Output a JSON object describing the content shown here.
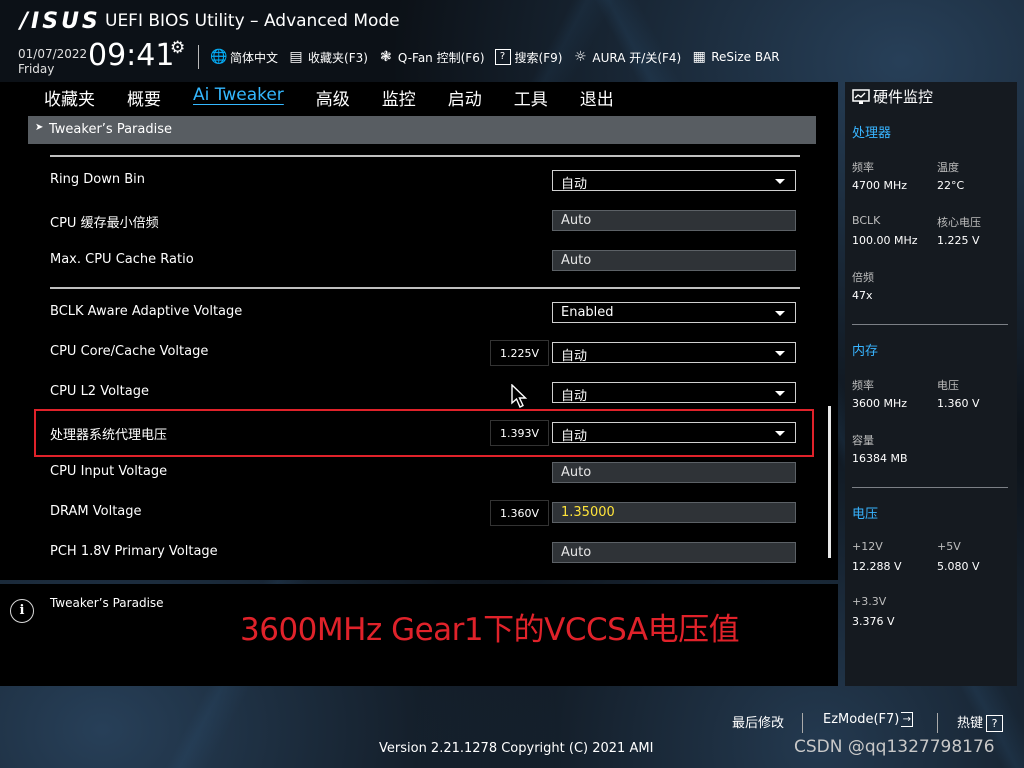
{
  "header": {
    "logo": "/ISUS",
    "title": "UEFI BIOS Utility – Advanced Mode",
    "date": "01/07/2022",
    "day": "Friday",
    "time": "09:41",
    "toolbar": [
      {
        "icon": "globe-icon",
        "label": "简体中文"
      },
      {
        "icon": "bookmark-icon",
        "label": "收藏夹(F3)"
      },
      {
        "icon": "fan-icon",
        "label": "Q-Fan 控制(F6)"
      },
      {
        "icon": "help-icon",
        "label": "搜索(F9)"
      },
      {
        "icon": "aura-icon",
        "label": "AURA 开/关(F4)"
      },
      {
        "icon": "resize-bar-icon",
        "label": "ReSize BAR"
      }
    ]
  },
  "menu": [
    "收藏夹",
    "概要",
    "Ai Tweaker",
    "高级",
    "监控",
    "启动",
    "工具",
    "退出"
  ],
  "menu_active": "Ai Tweaker",
  "breadcrumb": "Tweaker’s Paradise",
  "settings": [
    {
      "label": "Ring Down Bin",
      "value": "自动",
      "type": "dropdown"
    },
    {
      "label": "CPU 缓存最小倍频",
      "value": "Auto",
      "type": "text"
    },
    {
      "label": "Max. CPU Cache Ratio",
      "value": "Auto",
      "type": "text"
    },
    {
      "label": "BCLK Aware Adaptive Voltage",
      "value": "Enabled",
      "type": "dropdown"
    },
    {
      "label": "CPU Core/Cache Voltage",
      "value": "自动",
      "type": "dropdown",
      "reading": "1.225V"
    },
    {
      "label": "CPU L2 Voltage",
      "value": "自动",
      "type": "dropdown"
    },
    {
      "label": "处理器系统代理电压",
      "value": "自动",
      "type": "dropdown",
      "reading": "1.393V",
      "highlighted": true
    },
    {
      "label": "CPU Input Voltage",
      "value": "Auto",
      "type": "text"
    },
    {
      "label": "DRAM Voltage",
      "value": "1.35000",
      "type": "text",
      "reading": "1.360V"
    },
    {
      "label": "PCH 1.8V Primary Voltage",
      "value": "Auto",
      "type": "text"
    }
  ],
  "help": {
    "text": "Tweaker’s Paradise",
    "annotation": "3600MHz Gear1下的VCCSA电压值"
  },
  "monitor": {
    "title": "硬件监控",
    "sections": [
      {
        "name": "处理器",
        "items": [
          {
            "label": "频率",
            "value": "4700 MHz"
          },
          {
            "label": "温度",
            "value": "22°C"
          },
          {
            "label": "BCLK",
            "value": "100.00 MHz"
          },
          {
            "label": "核心电压",
            "value": "1.225 V"
          },
          {
            "label": "倍频",
            "value": "47x"
          }
        ]
      },
      {
        "name": "内存",
        "items": [
          {
            "label": "频率",
            "value": "3600 MHz"
          },
          {
            "label": "电压",
            "value": "1.360 V"
          },
          {
            "label": "容量",
            "value": "16384 MB"
          }
        ]
      },
      {
        "name": "电压",
        "items": [
          {
            "label": "+12V",
            "value": "12.288 V"
          },
          {
            "label": "+5V",
            "value": "5.080 V"
          },
          {
            "label": "+3.3V",
            "value": "3.376 V"
          }
        ]
      }
    ]
  },
  "footer": {
    "last_modified": "最后修改",
    "ezmode": "EzMode(F7)",
    "hotkeys": "热键",
    "hotkeys_key": "?",
    "version": "Version 2.21.1278 Copyright (C) 2021 AMI",
    "watermark": "CSDN @qq1327798176"
  },
  "colors": {
    "accent": "#34b8ff",
    "highlight": "#e0222a",
    "dram_value": "#ffe43a"
  }
}
